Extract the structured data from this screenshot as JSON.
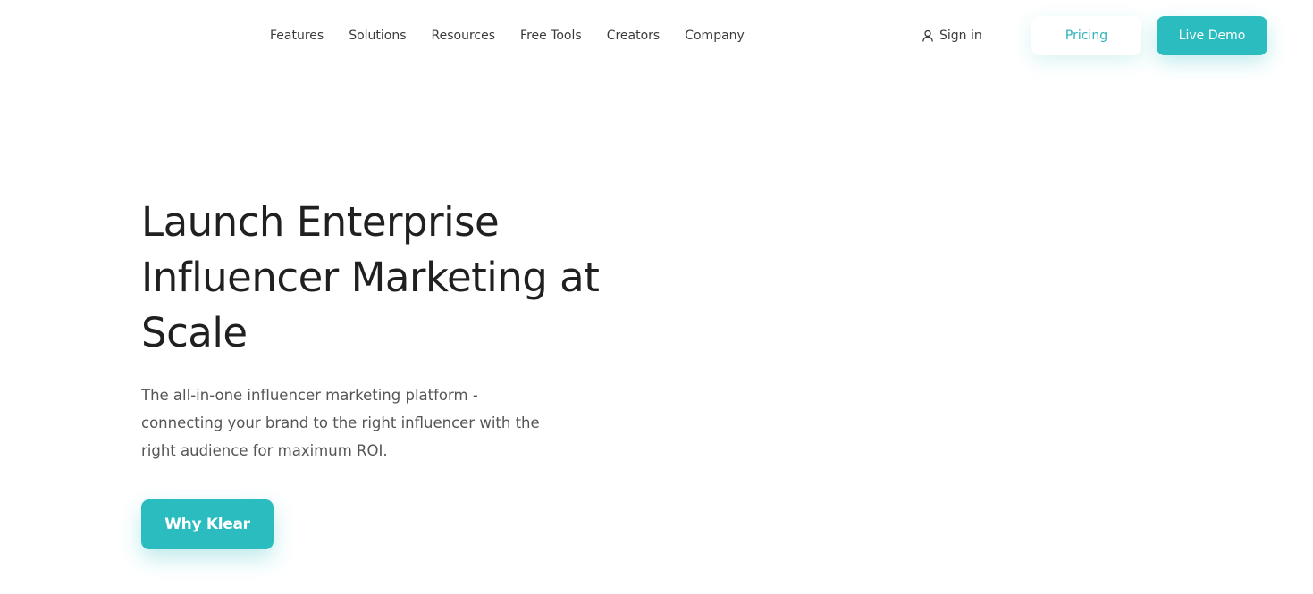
{
  "header": {
    "nav": [
      {
        "label": "Features"
      },
      {
        "label": "Solutions"
      },
      {
        "label": "Resources"
      },
      {
        "label": "Free Tools"
      },
      {
        "label": "Creators"
      },
      {
        "label": "Company"
      }
    ],
    "sign_in": {
      "label": "Sign in",
      "icon": "user-icon"
    },
    "pricing_label": "Pricing",
    "demo_label": "Live Demo"
  },
  "hero": {
    "title": "Launch Enterprise Influencer Marketing at Scale",
    "subtitle": "The all-in-one influencer marketing platform - connecting your brand to the right influencer with the right audience for maximum ROI.",
    "cta_label": "Why Klear"
  },
  "colors": {
    "accent": "#2bbcbf",
    "text_dark": "#202020",
    "text_muted": "#555555",
    "background": "#ffffff"
  }
}
